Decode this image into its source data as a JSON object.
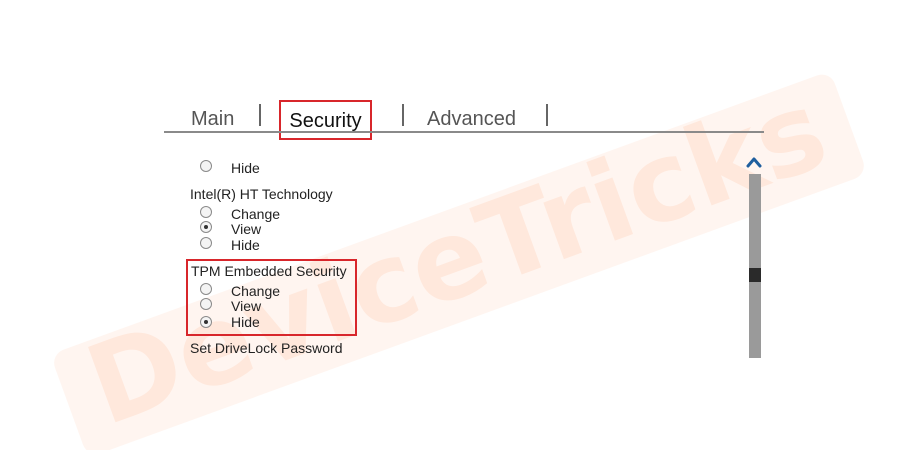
{
  "tabs": {
    "main": "Main",
    "security": "Security",
    "advanced": "Advanced"
  },
  "settings": {
    "partial_option": {
      "hide": "Hide"
    },
    "ht_technology": {
      "label": "Intel(R) HT Technology",
      "change": "Change",
      "view": "View",
      "hide": "Hide",
      "selected": "View"
    },
    "tpm_security": {
      "label": "TPM Embedded Security",
      "change": "Change",
      "view": "View",
      "hide": "Hide",
      "selected": "Hide"
    },
    "drivelock": {
      "label": "Set DriveLock Password"
    }
  },
  "icons": {
    "scroll_up": "chevron-up-icon"
  },
  "colors": {
    "highlight": "#d8262b",
    "scroll_track": "#9a9a9a",
    "scroll_thumb": "#2a2a2a",
    "accent": "#1f5f9e"
  }
}
